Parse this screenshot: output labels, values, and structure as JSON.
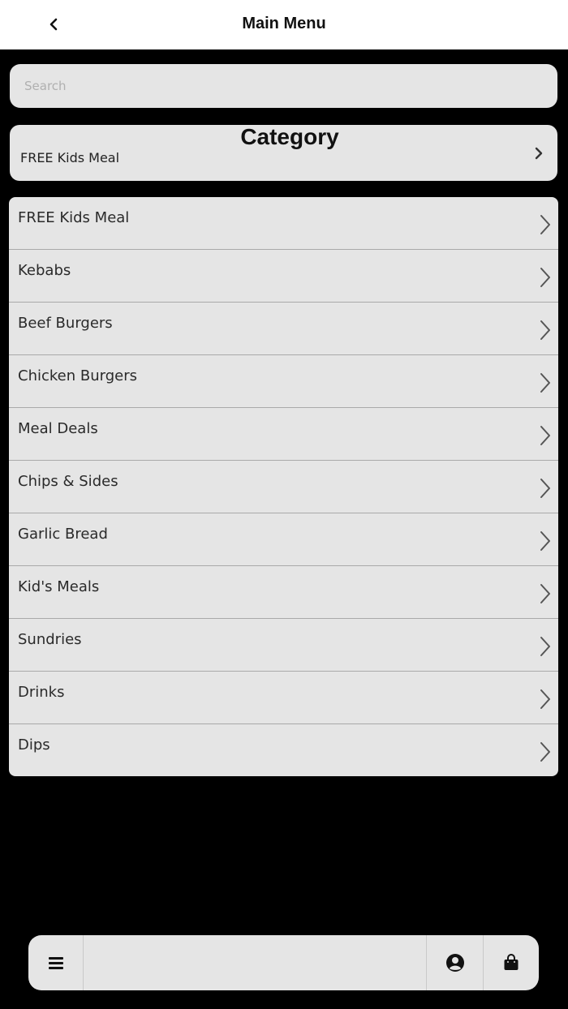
{
  "header": {
    "title": "Main Menu",
    "back_icon": "chevron-left-icon"
  },
  "search": {
    "placeholder": "Search",
    "value": ""
  },
  "category": {
    "title": "Category",
    "selected": "FREE Kids Meal",
    "icon": "chevron-right-icon"
  },
  "menu": {
    "items": [
      {
        "label": "FREE Kids Meal"
      },
      {
        "label": "Kebabs"
      },
      {
        "label": "Beef Burgers"
      },
      {
        "label": "Chicken Burgers"
      },
      {
        "label": "Meal Deals"
      },
      {
        "label": "Chips & Sides"
      },
      {
        "label": "Garlic Bread"
      },
      {
        "label": "Kid's Meals"
      },
      {
        "label": "Sundries"
      },
      {
        "label": "Drinks"
      },
      {
        "label": "Dips"
      }
    ],
    "item_icon": "chevron-right-icon"
  },
  "bottom_bar": {
    "menu_icon": "hamburger-menu-icon",
    "account_icon": "user-circle-icon",
    "cart_icon": "shopping-bag-icon"
  },
  "colors": {
    "background": "#000000",
    "header_bg": "#ffffff",
    "card_bg": "#e5e5e5",
    "text": "#222222",
    "divider": "#a9a9a9"
  }
}
